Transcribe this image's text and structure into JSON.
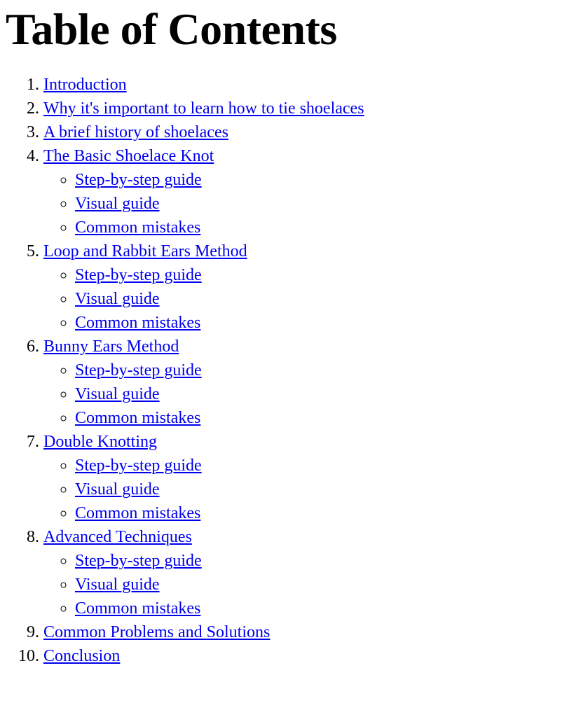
{
  "document": {
    "title": "Table of Contents",
    "link_color": "#0000EE",
    "text_color": "#000000",
    "background_color": "#FFFFFF",
    "sub_marker": "circle"
  },
  "toc": {
    "items": [
      {
        "number": "1.",
        "label": "Introduction",
        "children": []
      },
      {
        "number": "2.",
        "label": "Why it's important to learn how to tie shoelaces",
        "children": []
      },
      {
        "number": "3.",
        "label": "A brief history of shoelaces",
        "children": []
      },
      {
        "number": "4.",
        "label": "The Basic Shoelace Knot",
        "children": [
          {
            "label": "Step-by-step guide"
          },
          {
            "label": "Visual guide"
          },
          {
            "label": "Common mistakes"
          }
        ]
      },
      {
        "number": "5.",
        "label": "Loop and Rabbit Ears Method",
        "children": [
          {
            "label": "Step-by-step guide"
          },
          {
            "label": "Visual guide"
          },
          {
            "label": "Common mistakes"
          }
        ]
      },
      {
        "number": "6.",
        "label": "Bunny Ears Method",
        "children": [
          {
            "label": "Step-by-step guide"
          },
          {
            "label": "Visual guide"
          },
          {
            "label": "Common mistakes"
          }
        ]
      },
      {
        "number": "7.",
        "label": "Double Knotting",
        "children": [
          {
            "label": "Step-by-step guide"
          },
          {
            "label": "Visual guide"
          },
          {
            "label": "Common mistakes"
          }
        ]
      },
      {
        "number": "8.",
        "label": "Advanced Techniques",
        "children": [
          {
            "label": "Step-by-step guide"
          },
          {
            "label": "Visual guide"
          },
          {
            "label": "Common mistakes"
          }
        ]
      },
      {
        "number": "9.",
        "label": "Common Problems and Solutions",
        "children": []
      },
      {
        "number": "10.",
        "label": "Conclusion",
        "children": []
      }
    ]
  }
}
